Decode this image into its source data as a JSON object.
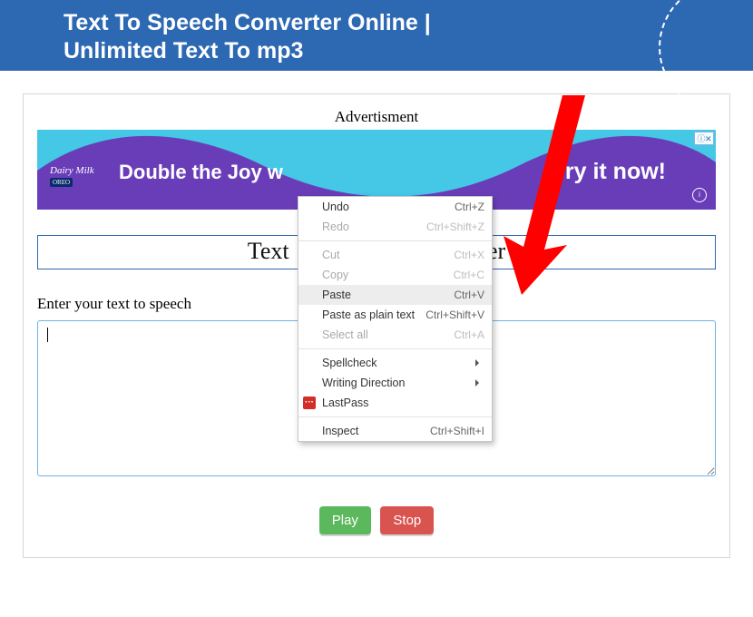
{
  "header": {
    "title_line1": "Text To Speech Converter Online |",
    "title_line2": "Unlimited Text To mp3"
  },
  "ad": {
    "label": "Advertisment",
    "text_left": "Double the Joy w",
    "text_right": "Try it now!",
    "brand_top": "Dairy Milk",
    "brand_sub": "OREO",
    "close": "ⓘ✕"
  },
  "main": {
    "title": "Text To Speech Converter",
    "title_visible_left": "Text",
    "title_visible_right": "ter",
    "input_label": "Enter your text to speech",
    "textarea_value": "",
    "play_label": "Play",
    "stop_label": "Stop"
  },
  "context_menu": {
    "items": [
      {
        "label": "Undo",
        "shortcut": "Ctrl+Z",
        "disabled": false
      },
      {
        "label": "Redo",
        "shortcut": "Ctrl+Shift+Z",
        "disabled": true
      },
      {
        "sep": true
      },
      {
        "label": "Cut",
        "shortcut": "Ctrl+X",
        "disabled": true
      },
      {
        "label": "Copy",
        "shortcut": "Ctrl+C",
        "disabled": true
      },
      {
        "label": "Paste",
        "shortcut": "Ctrl+V",
        "disabled": false,
        "hover": true
      },
      {
        "label": "Paste as plain text",
        "shortcut": "Ctrl+Shift+V",
        "disabled": false
      },
      {
        "label": "Select all",
        "shortcut": "Ctrl+A",
        "disabled": true
      },
      {
        "sep": true
      },
      {
        "label": "Spellcheck",
        "submenu": true
      },
      {
        "label": "Writing Direction",
        "submenu": true
      },
      {
        "label": "LastPass",
        "icon": "lp"
      },
      {
        "sep": true
      },
      {
        "label": "Inspect",
        "shortcut": "Ctrl+Shift+I"
      }
    ]
  }
}
